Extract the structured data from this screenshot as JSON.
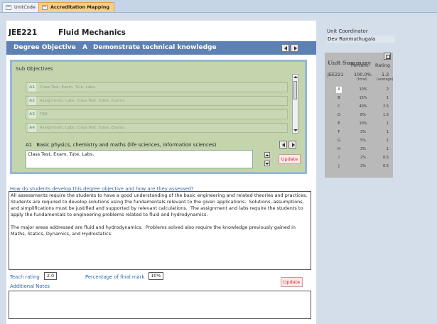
{
  "tabs": [
    {
      "label": "UnitCode"
    },
    {
      "label": "Accreditation Mapping"
    }
  ],
  "unit": {
    "code": "JEE221",
    "name": "Fluid Mechanics"
  },
  "degree_objective": {
    "label": "Degree Objective",
    "letter": "A",
    "title": "Demonstrate technical knowledge"
  },
  "sub_objectives": {
    "title": "Sub Objectives",
    "items": [
      {
        "code": "A1",
        "text": "Class Test, Exam, Tute, Labs."
      },
      {
        "code": "A2",
        "text": "Assignment, Labs, Class Test, Tutes, Exams."
      },
      {
        "code": "A3",
        "text": "TBA"
      },
      {
        "code": "A4",
        "text": "Assignment, Labs, Class Test, Tutes, Exams."
      }
    ],
    "selected": {
      "code": "A1",
      "title": "Basic physics, chemistry and maths (life sciences, information sciences)",
      "value": "Class Test, Exam, Tute, Labs."
    },
    "update_label": "Update"
  },
  "assessment": {
    "question": "How do students develop this degree objective and how are they assessed?",
    "answer": "All assessments require the students to have a good understanding of the basic engineering and related theories and practices.  Students are required to develop solutions using the fundamentals relevant to the given applications.  Solutions, assumptions, and simplifications must be justified and supported by relevant calculations.  The assignment and labs require the students to apply the fundamentals to engineering problems related to fluid and hydrodynamics.\n\nThe major areas addressed are fluid and hydrodynamics.  Problems solved also require the knowledge previously gained in Maths, Statics, Dynamics, and Hydrostatics."
  },
  "teach": {
    "rating_label": "Teach rating",
    "rating_value": "2.0",
    "pct_label": "Percentage of final mark",
    "pct_value": "10%",
    "notes_label": "Additional Notes",
    "update_label": "Update"
  },
  "coordinator": {
    "label": "Unit Coordinator",
    "name": "Dev Ranmuthugala"
  },
  "unit_summary": {
    "title": "Unit Summary",
    "col_percent": "Percent",
    "col_rating": "Rating",
    "total_code": "JEE221",
    "total_percent": "100.0%",
    "total_rating": "1.2",
    "total_note": "(total)",
    "average_note": "(average)",
    "rows": [
      {
        "letter": "A",
        "percent": "10%",
        "rating": "2"
      },
      {
        "letter": "B",
        "percent": "15%",
        "rating": "1"
      },
      {
        "letter": "C",
        "percent": "40%",
        "rating": "2.5"
      },
      {
        "letter": "D",
        "percent": "8%",
        "rating": "1.5"
      },
      {
        "letter": "E",
        "percent": "10%",
        "rating": "1"
      },
      {
        "letter": "F",
        "percent": "3%",
        "rating": "1"
      },
      {
        "letter": "G",
        "percent": "5%",
        "rating": "1"
      },
      {
        "letter": "H",
        "percent": "3%",
        "rating": "1"
      },
      {
        "letter": "I",
        "percent": "2%",
        "rating": "0.5"
      },
      {
        "letter": "J",
        "percent": "2%",
        "rating": "0.5"
      }
    ]
  }
}
